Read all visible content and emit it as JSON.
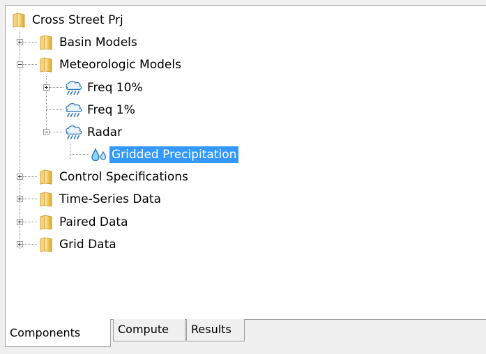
{
  "tree": {
    "root": {
      "label": "Cross Street Prj",
      "icon": "folder-icon"
    },
    "items": [
      {
        "label": "Basin Models",
        "icon": "folder-icon",
        "expander": "plus"
      },
      {
        "label": "Meteorologic Models",
        "icon": "folder-icon",
        "expander": "minus"
      },
      {
        "label": "Freq 10%",
        "icon": "rain-cloud-icon",
        "expander": "plus"
      },
      {
        "label": "Freq 1%",
        "icon": "rain-cloud-icon",
        "expander": ""
      },
      {
        "label": "Radar",
        "icon": "rain-cloud-icon",
        "expander": "minus"
      },
      {
        "label": "Gridded Precipitation",
        "icon": "water-drops-icon",
        "expander": "",
        "selected": true
      },
      {
        "label": "Control Specifications",
        "icon": "folder-icon",
        "expander": "plus"
      },
      {
        "label": "Time-Series Data",
        "icon": "folder-icon",
        "expander": "plus"
      },
      {
        "label": "Paired Data",
        "icon": "folder-icon",
        "expander": "plus"
      },
      {
        "label": "Grid Data",
        "icon": "folder-icon",
        "expander": "plus"
      }
    ]
  },
  "tabs": [
    {
      "label": "Components",
      "active": true
    },
    {
      "label": "Compute",
      "active": false
    },
    {
      "label": "Results",
      "active": false
    }
  ],
  "colors": {
    "selection": "#3399ff",
    "folder": "#f0c060"
  }
}
